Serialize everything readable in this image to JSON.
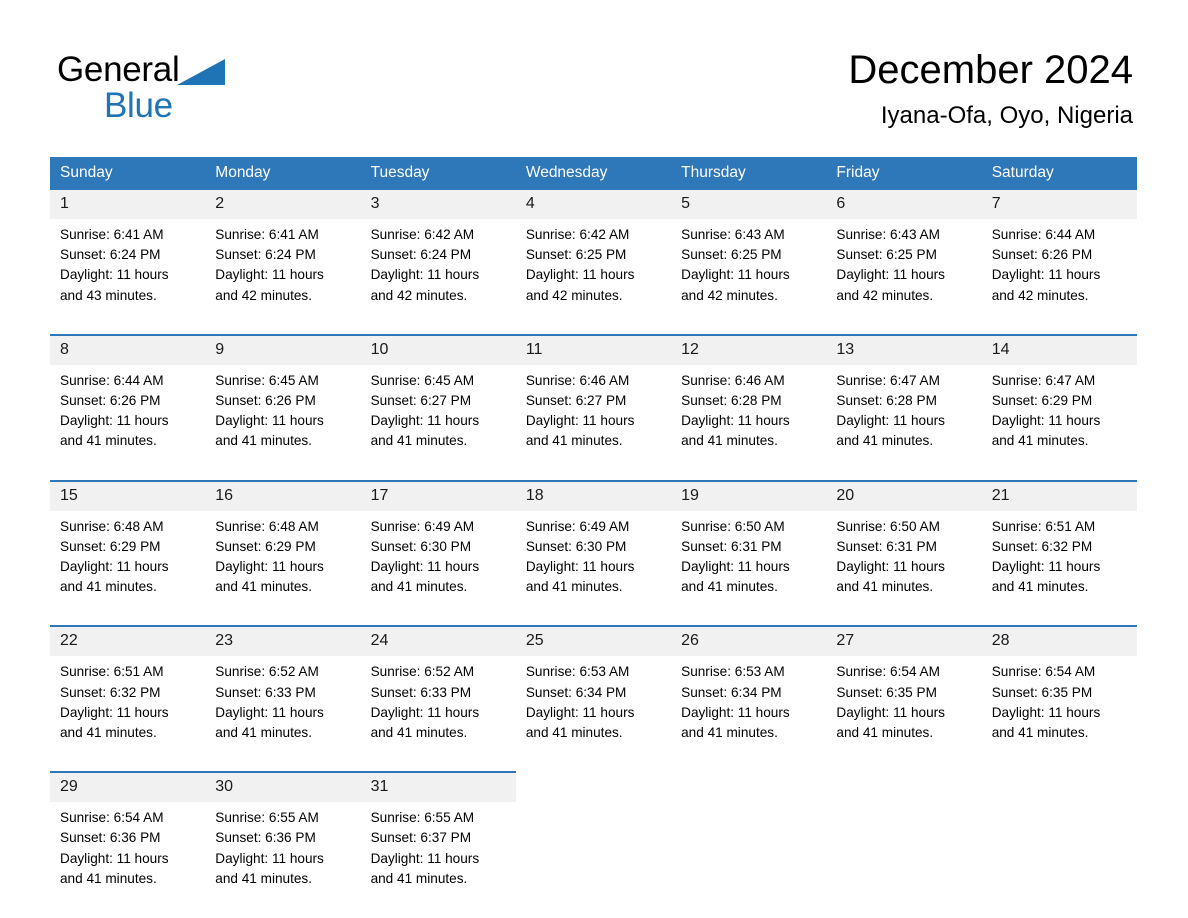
{
  "brand": {
    "name_part1": "General",
    "name_part2": "Blue",
    "accent_color": "#1f74b5"
  },
  "header": {
    "title": "December 2024",
    "location": "Iyana-Ofa, Oyo, Nigeria"
  },
  "calendar": {
    "header_bg": "#2e77b8",
    "daynum_bg": "#f1f1f1",
    "weekdays": [
      "Sunday",
      "Monday",
      "Tuesday",
      "Wednesday",
      "Thursday",
      "Friday",
      "Saturday"
    ],
    "weeks": [
      [
        {
          "day": "1",
          "sunrise": "Sunrise: 6:41 AM",
          "sunset": "Sunset: 6:24 PM",
          "daylight_line1": "Daylight: 11 hours",
          "daylight_line2": "and 43 minutes."
        },
        {
          "day": "2",
          "sunrise": "Sunrise: 6:41 AM",
          "sunset": "Sunset: 6:24 PM",
          "daylight_line1": "Daylight: 11 hours",
          "daylight_line2": "and 42 minutes."
        },
        {
          "day": "3",
          "sunrise": "Sunrise: 6:42 AM",
          "sunset": "Sunset: 6:24 PM",
          "daylight_line1": "Daylight: 11 hours",
          "daylight_line2": "and 42 minutes."
        },
        {
          "day": "4",
          "sunrise": "Sunrise: 6:42 AM",
          "sunset": "Sunset: 6:25 PM",
          "daylight_line1": "Daylight: 11 hours",
          "daylight_line2": "and 42 minutes."
        },
        {
          "day": "5",
          "sunrise": "Sunrise: 6:43 AM",
          "sunset": "Sunset: 6:25 PM",
          "daylight_line1": "Daylight: 11 hours",
          "daylight_line2": "and 42 minutes."
        },
        {
          "day": "6",
          "sunrise": "Sunrise: 6:43 AM",
          "sunset": "Sunset: 6:25 PM",
          "daylight_line1": "Daylight: 11 hours",
          "daylight_line2": "and 42 minutes."
        },
        {
          "day": "7",
          "sunrise": "Sunrise: 6:44 AM",
          "sunset": "Sunset: 6:26 PM",
          "daylight_line1": "Daylight: 11 hours",
          "daylight_line2": "and 42 minutes."
        }
      ],
      [
        {
          "day": "8",
          "sunrise": "Sunrise: 6:44 AM",
          "sunset": "Sunset: 6:26 PM",
          "daylight_line1": "Daylight: 11 hours",
          "daylight_line2": "and 41 minutes."
        },
        {
          "day": "9",
          "sunrise": "Sunrise: 6:45 AM",
          "sunset": "Sunset: 6:26 PM",
          "daylight_line1": "Daylight: 11 hours",
          "daylight_line2": "and 41 minutes."
        },
        {
          "day": "10",
          "sunrise": "Sunrise: 6:45 AM",
          "sunset": "Sunset: 6:27 PM",
          "daylight_line1": "Daylight: 11 hours",
          "daylight_line2": "and 41 minutes."
        },
        {
          "day": "11",
          "sunrise": "Sunrise: 6:46 AM",
          "sunset": "Sunset: 6:27 PM",
          "daylight_line1": "Daylight: 11 hours",
          "daylight_line2": "and 41 minutes."
        },
        {
          "day": "12",
          "sunrise": "Sunrise: 6:46 AM",
          "sunset": "Sunset: 6:28 PM",
          "daylight_line1": "Daylight: 11 hours",
          "daylight_line2": "and 41 minutes."
        },
        {
          "day": "13",
          "sunrise": "Sunrise: 6:47 AM",
          "sunset": "Sunset: 6:28 PM",
          "daylight_line1": "Daylight: 11 hours",
          "daylight_line2": "and 41 minutes."
        },
        {
          "day": "14",
          "sunrise": "Sunrise: 6:47 AM",
          "sunset": "Sunset: 6:29 PM",
          "daylight_line1": "Daylight: 11 hours",
          "daylight_line2": "and 41 minutes."
        }
      ],
      [
        {
          "day": "15",
          "sunrise": "Sunrise: 6:48 AM",
          "sunset": "Sunset: 6:29 PM",
          "daylight_line1": "Daylight: 11 hours",
          "daylight_line2": "and 41 minutes."
        },
        {
          "day": "16",
          "sunrise": "Sunrise: 6:48 AM",
          "sunset": "Sunset: 6:29 PM",
          "daylight_line1": "Daylight: 11 hours",
          "daylight_line2": "and 41 minutes."
        },
        {
          "day": "17",
          "sunrise": "Sunrise: 6:49 AM",
          "sunset": "Sunset: 6:30 PM",
          "daylight_line1": "Daylight: 11 hours",
          "daylight_line2": "and 41 minutes."
        },
        {
          "day": "18",
          "sunrise": "Sunrise: 6:49 AM",
          "sunset": "Sunset: 6:30 PM",
          "daylight_line1": "Daylight: 11 hours",
          "daylight_line2": "and 41 minutes."
        },
        {
          "day": "19",
          "sunrise": "Sunrise: 6:50 AM",
          "sunset": "Sunset: 6:31 PM",
          "daylight_line1": "Daylight: 11 hours",
          "daylight_line2": "and 41 minutes."
        },
        {
          "day": "20",
          "sunrise": "Sunrise: 6:50 AM",
          "sunset": "Sunset: 6:31 PM",
          "daylight_line1": "Daylight: 11 hours",
          "daylight_line2": "and 41 minutes."
        },
        {
          "day": "21",
          "sunrise": "Sunrise: 6:51 AM",
          "sunset": "Sunset: 6:32 PM",
          "daylight_line1": "Daylight: 11 hours",
          "daylight_line2": "and 41 minutes."
        }
      ],
      [
        {
          "day": "22",
          "sunrise": "Sunrise: 6:51 AM",
          "sunset": "Sunset: 6:32 PM",
          "daylight_line1": "Daylight: 11 hours",
          "daylight_line2": "and 41 minutes."
        },
        {
          "day": "23",
          "sunrise": "Sunrise: 6:52 AM",
          "sunset": "Sunset: 6:33 PM",
          "daylight_line1": "Daylight: 11 hours",
          "daylight_line2": "and 41 minutes."
        },
        {
          "day": "24",
          "sunrise": "Sunrise: 6:52 AM",
          "sunset": "Sunset: 6:33 PM",
          "daylight_line1": "Daylight: 11 hours",
          "daylight_line2": "and 41 minutes."
        },
        {
          "day": "25",
          "sunrise": "Sunrise: 6:53 AM",
          "sunset": "Sunset: 6:34 PM",
          "daylight_line1": "Daylight: 11 hours",
          "daylight_line2": "and 41 minutes."
        },
        {
          "day": "26",
          "sunrise": "Sunrise: 6:53 AM",
          "sunset": "Sunset: 6:34 PM",
          "daylight_line1": "Daylight: 11 hours",
          "daylight_line2": "and 41 minutes."
        },
        {
          "day": "27",
          "sunrise": "Sunrise: 6:54 AM",
          "sunset": "Sunset: 6:35 PM",
          "daylight_line1": "Daylight: 11 hours",
          "daylight_line2": "and 41 minutes."
        },
        {
          "day": "28",
          "sunrise": "Sunrise: 6:54 AM",
          "sunset": "Sunset: 6:35 PM",
          "daylight_line1": "Daylight: 11 hours",
          "daylight_line2": "and 41 minutes."
        }
      ],
      [
        {
          "day": "29",
          "sunrise": "Sunrise: 6:54 AM",
          "sunset": "Sunset: 6:36 PM",
          "daylight_line1": "Daylight: 11 hours",
          "daylight_line2": "and 41 minutes."
        },
        {
          "day": "30",
          "sunrise": "Sunrise: 6:55 AM",
          "sunset": "Sunset: 6:36 PM",
          "daylight_line1": "Daylight: 11 hours",
          "daylight_line2": "and 41 minutes."
        },
        {
          "day": "31",
          "sunrise": "Sunrise: 6:55 AM",
          "sunset": "Sunset: 6:37 PM",
          "daylight_line1": "Daylight: 11 hours",
          "daylight_line2": "and 41 minutes."
        },
        {
          "day": "",
          "sunrise": "",
          "sunset": "",
          "daylight_line1": "",
          "daylight_line2": ""
        },
        {
          "day": "",
          "sunrise": "",
          "sunset": "",
          "daylight_line1": "",
          "daylight_line2": ""
        },
        {
          "day": "",
          "sunrise": "",
          "sunset": "",
          "daylight_line1": "",
          "daylight_line2": ""
        },
        {
          "day": "",
          "sunrise": "",
          "sunset": "",
          "daylight_line1": "",
          "daylight_line2": ""
        }
      ]
    ]
  }
}
